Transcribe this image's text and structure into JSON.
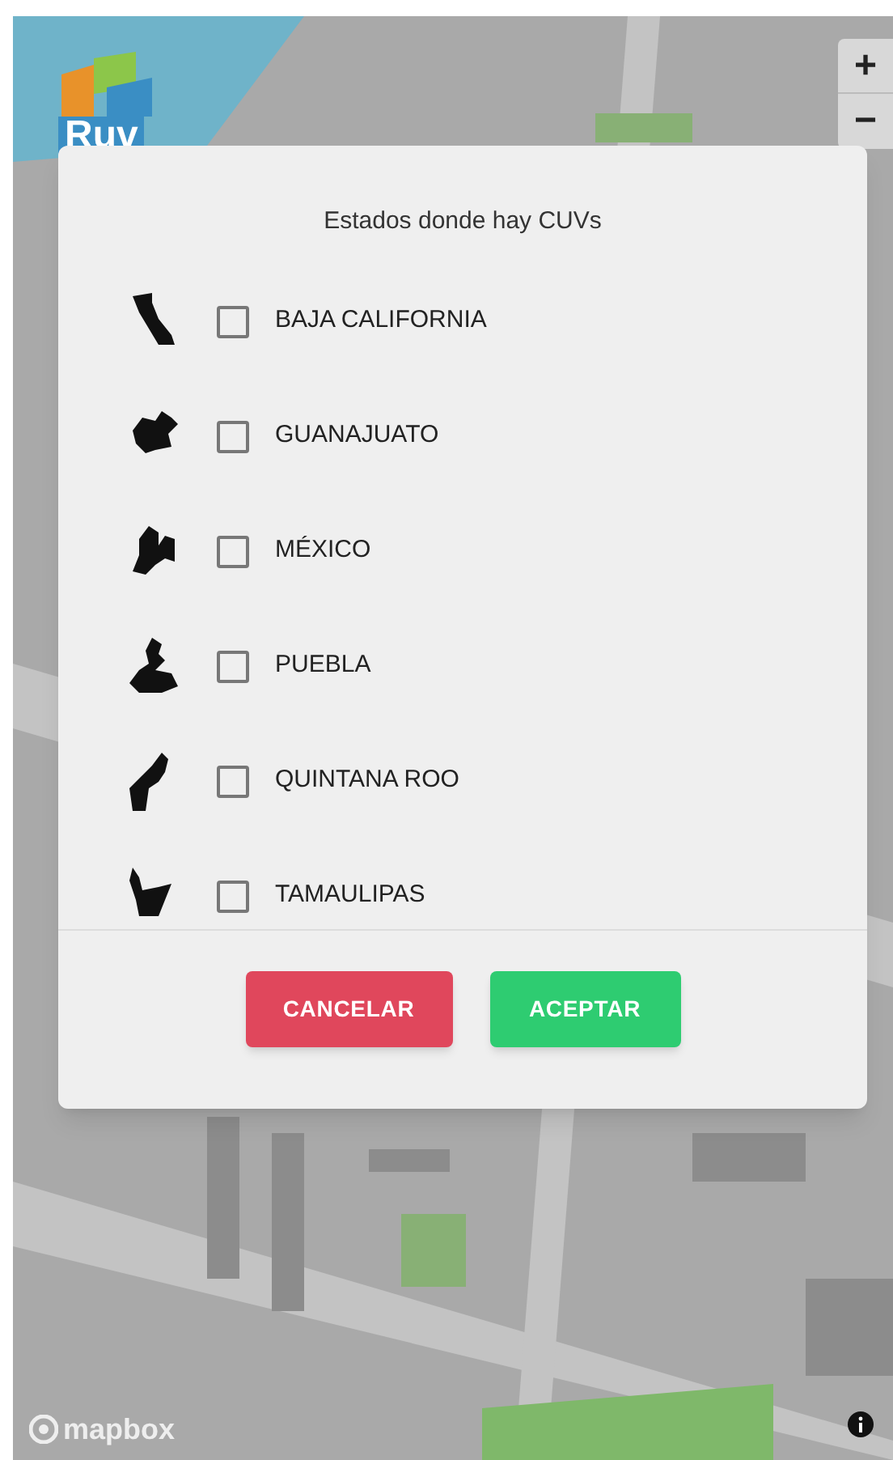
{
  "logo": {
    "text": "Ruv"
  },
  "zoom_controls": [
    {
      "label": "+"
    },
    {
      "label": "−"
    }
  ],
  "attribution": {
    "text": "mapbox"
  },
  "dialog": {
    "title": "Estados donde hay CUVs",
    "states": [
      {
        "name": "BAJA CALIFORNIA",
        "checked": false
      },
      {
        "name": "GUANAJUATO",
        "checked": false
      },
      {
        "name": "MÉXICO",
        "checked": false
      },
      {
        "name": "PUEBLA",
        "checked": false
      },
      {
        "name": "QUINTANA ROO",
        "checked": false
      },
      {
        "name": "TAMAULIPAS",
        "checked": false
      }
    ],
    "buttons": [
      {
        "label": "CANCELAR",
        "kind": "cancel"
      },
      {
        "label": "ACEPTAR",
        "kind": "accept"
      }
    ]
  }
}
